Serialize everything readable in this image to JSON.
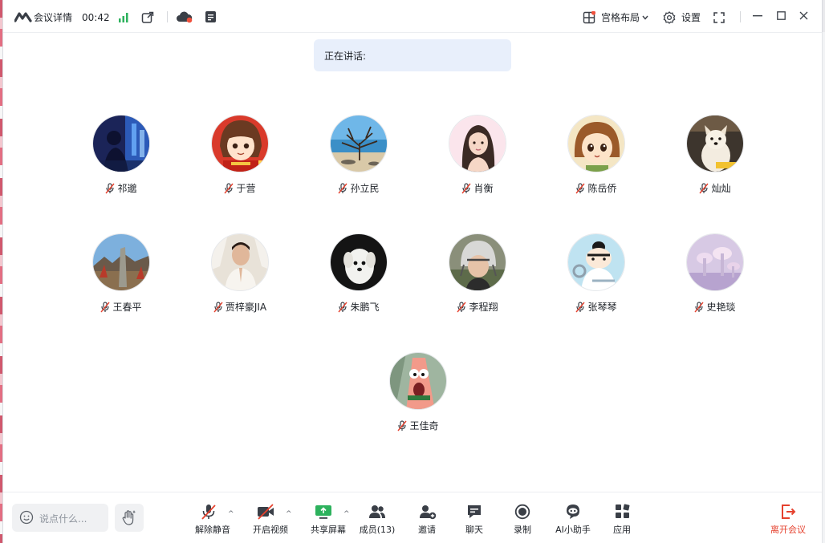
{
  "titlebar": {
    "meeting_details": "会议详情",
    "duration": "00:42",
    "layout_label": "宫格布局",
    "settings_label": "设置"
  },
  "speaking": {
    "label": "正在讲话:"
  },
  "participants": [
    {
      "name": "祁邈",
      "avatar": "night-city-photo-icon"
    },
    {
      "name": "于营",
      "avatar": "anime-girl-icon"
    },
    {
      "name": "孙立民",
      "avatar": "beach-tree-photo-icon"
    },
    {
      "name": "肖衡",
      "avatar": "woman-portrait-icon"
    },
    {
      "name": "陈岳侨",
      "avatar": "cartoon-girl-icon"
    },
    {
      "name": "灿灿",
      "avatar": "dog-photo-icon"
    },
    {
      "name": "王春平",
      "avatar": "landscape-photo-icon"
    },
    {
      "name": "贾梓豪JIA",
      "avatar": "man-portrait-icon"
    },
    {
      "name": "朱鹏飞",
      "avatar": "white-dog-photo-icon"
    },
    {
      "name": "李程翔",
      "avatar": "helmet-portrait-icon"
    },
    {
      "name": "张琴琴",
      "avatar": "cartoon-character-icon"
    },
    {
      "name": "史艳琰",
      "avatar": "mushroom-illustration-icon"
    },
    {
      "name": "王佳奇",
      "avatar": "cartoon-starfish-icon"
    }
  ],
  "toolbar": {
    "chat_placeholder": "说点什么...",
    "unmute_label": "解除静音",
    "video_label": "开启视频",
    "share_label": "共享屏幕",
    "members_label": "成员(13)",
    "invite_label": "邀请",
    "chat_label": "聊天",
    "record_label": "录制",
    "ai_label": "AI小助手",
    "apps_label": "应用",
    "leave_label": "离开会议"
  },
  "colors": {
    "accent": "#1f2329",
    "signal": "#2db25d",
    "banner_bg": "#e8effb",
    "leave": "#e5412e",
    "muted_slash": "#e5412e",
    "notify_dot": "#f0503c"
  }
}
